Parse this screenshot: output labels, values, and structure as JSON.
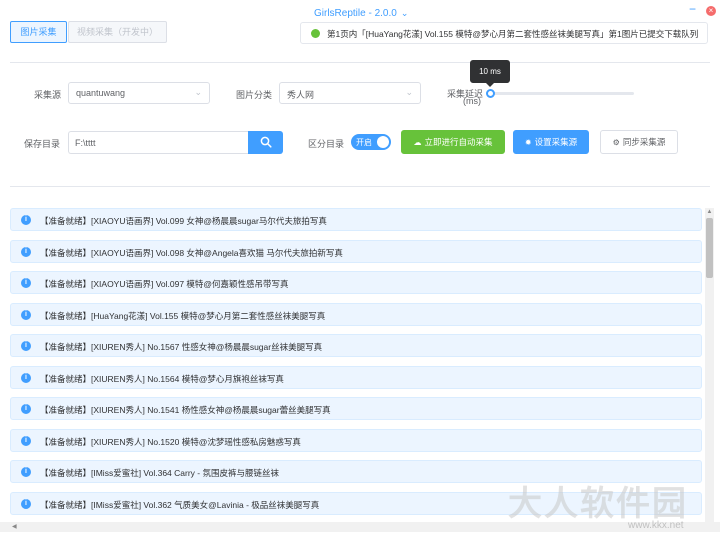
{
  "app": {
    "title": "GirlsReptile - 2.0.0",
    "chevron_icon": "chevron-down-icon",
    "minimize_symbol": "−",
    "close_symbol": "×"
  },
  "mode_tabs": [
    {
      "label": "图片采集",
      "active": true
    },
    {
      "label": "视频采集（开发中）",
      "active": false
    }
  ],
  "notice": {
    "text": "第1页内「[HuaYang花漾] Vol.155 模特@梦心月第二套性感丝袜美腿写真」第1图片已提交下载队列",
    "status_color": "#67c23a"
  },
  "form": {
    "source_label": "采集源",
    "source_value": "quantuwang",
    "category_label": "图片分类",
    "category_value": "秀人网",
    "delay_label_line1": "采集延迟",
    "delay_label_line2": "(ms)",
    "delay_tooltip": "10 ms",
    "delay_value_ms": 10,
    "save_dir_label": "保存目录",
    "save_dir_value": "F:\\tttt",
    "split_dir_label": "区分目录",
    "split_dir_toggle_text": "开启",
    "split_dir_on": true
  },
  "buttons": {
    "auto_collect": "立即进行自动采集",
    "set_source": "设置采集源",
    "sync_source": "同步采集源"
  },
  "logs": [
    "【准备就绪】[XIAOYU语画界] Vol.099 女神@杨晨晨sugar马尔代夫旅拍写真",
    "【准备就绪】[XIAOYU语画界] Vol.098 女神@Angela喜欢猫 马尔代夫旅拍新写真",
    "【准备就绪】[XIAOYU语画界] Vol.097 模特@何嘉颖性感吊带写真",
    "【准备就绪】[HuaYang花漾] Vol.155 模特@梦心月第二套性感丝袜美腿写真",
    "【准备就绪】[XIUREN秀人] No.1567 性感女神@杨晨晨sugar丝袜美腿写真",
    "【准备就绪】[XIUREN秀人] No.1564 模特@梦心月旗袍丝袜写真",
    "【准备就绪】[XIUREN秀人] No.1541 杨性感女神@杨晨晨sugar蕾丝美腿写真",
    "【准备就绪】[XIUREN秀人] No.1520 模特@沈梦瑶性感私房魅惑写真",
    "【准备就绪】[IMiss爱蜜社] Vol.364 Carry - 氛围皮裤与腰链丝袜",
    "【准备就绪】[IMiss爱蜜社] Vol.362 气质美女@Lavinia - 极品丝袜美腿写真"
  ],
  "watermark": {
    "text": "大人软件园",
    "url": "www.kkx.net"
  }
}
